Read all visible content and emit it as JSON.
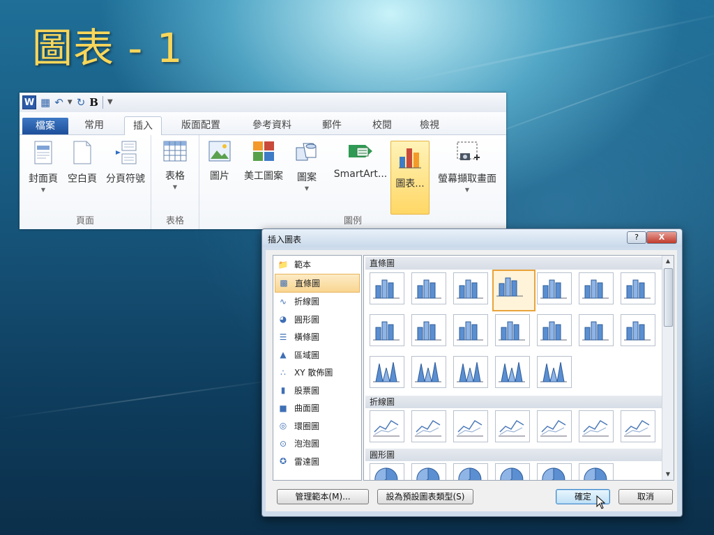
{
  "slide": {
    "title": "圖表 - 1"
  },
  "ribbon": {
    "quick_access": {
      "bold_label": "B"
    },
    "tabs": [
      {
        "label": "檔案",
        "kind": "file"
      },
      {
        "label": "常用"
      },
      {
        "label": "插入",
        "active": true
      },
      {
        "label": "版面配置"
      },
      {
        "label": "參考資料"
      },
      {
        "label": "郵件"
      },
      {
        "label": "校閱"
      },
      {
        "label": "檢視"
      }
    ],
    "groups": {
      "pages": {
        "label": "頁面",
        "buttons": {
          "cover": "封面頁",
          "blank": "空白頁",
          "page_break": "分頁符號"
        }
      },
      "tables": {
        "label": "表格",
        "buttons": {
          "table": "表格"
        }
      },
      "illustrations": {
        "label": "圖例",
        "buttons": {
          "picture": "圖片",
          "clipart": "美工圖案",
          "shapes": "圖案",
          "smartart": "SmartArt...",
          "chart": "圖表...",
          "screenshot": "螢幕擷取畫面"
        }
      }
    }
  },
  "dialog": {
    "title": "插入圖表",
    "title_buttons": {
      "help": "?",
      "close": "X"
    },
    "categories": [
      {
        "label": "範本",
        "icon": "folder-icon"
      },
      {
        "label": "直條圖",
        "icon": "column-chart-icon",
        "selected": true
      },
      {
        "label": "折線圖",
        "icon": "line-chart-icon"
      },
      {
        "label": "圓形圖",
        "icon": "pie-chart-icon"
      },
      {
        "label": "橫條圖",
        "icon": "bar-chart-icon"
      },
      {
        "label": "區域圖",
        "icon": "area-chart-icon"
      },
      {
        "label": "XY 散佈圖",
        "icon": "scatter-chart-icon"
      },
      {
        "label": "股票圖",
        "icon": "stock-chart-icon"
      },
      {
        "label": "曲面圖",
        "icon": "surface-chart-icon"
      },
      {
        "label": "環圈圖",
        "icon": "doughnut-chart-icon"
      },
      {
        "label": "泡泡圖",
        "icon": "bubble-chart-icon"
      },
      {
        "label": "雷達圖",
        "icon": "radar-chart-icon"
      }
    ],
    "sections": {
      "column": {
        "header": "直條圖"
      },
      "line": {
        "header": "折線圖"
      },
      "pie": {
        "header": "圓形圖"
      }
    },
    "buttons": {
      "manage_templates": "管理範本(M)...",
      "set_default": "設為預設圖表類型(S)",
      "ok": "確定",
      "cancel": "取消"
    },
    "colors": {
      "accent_selected": "#e8a33a",
      "bar_fill": "#5b8fd1"
    }
  }
}
